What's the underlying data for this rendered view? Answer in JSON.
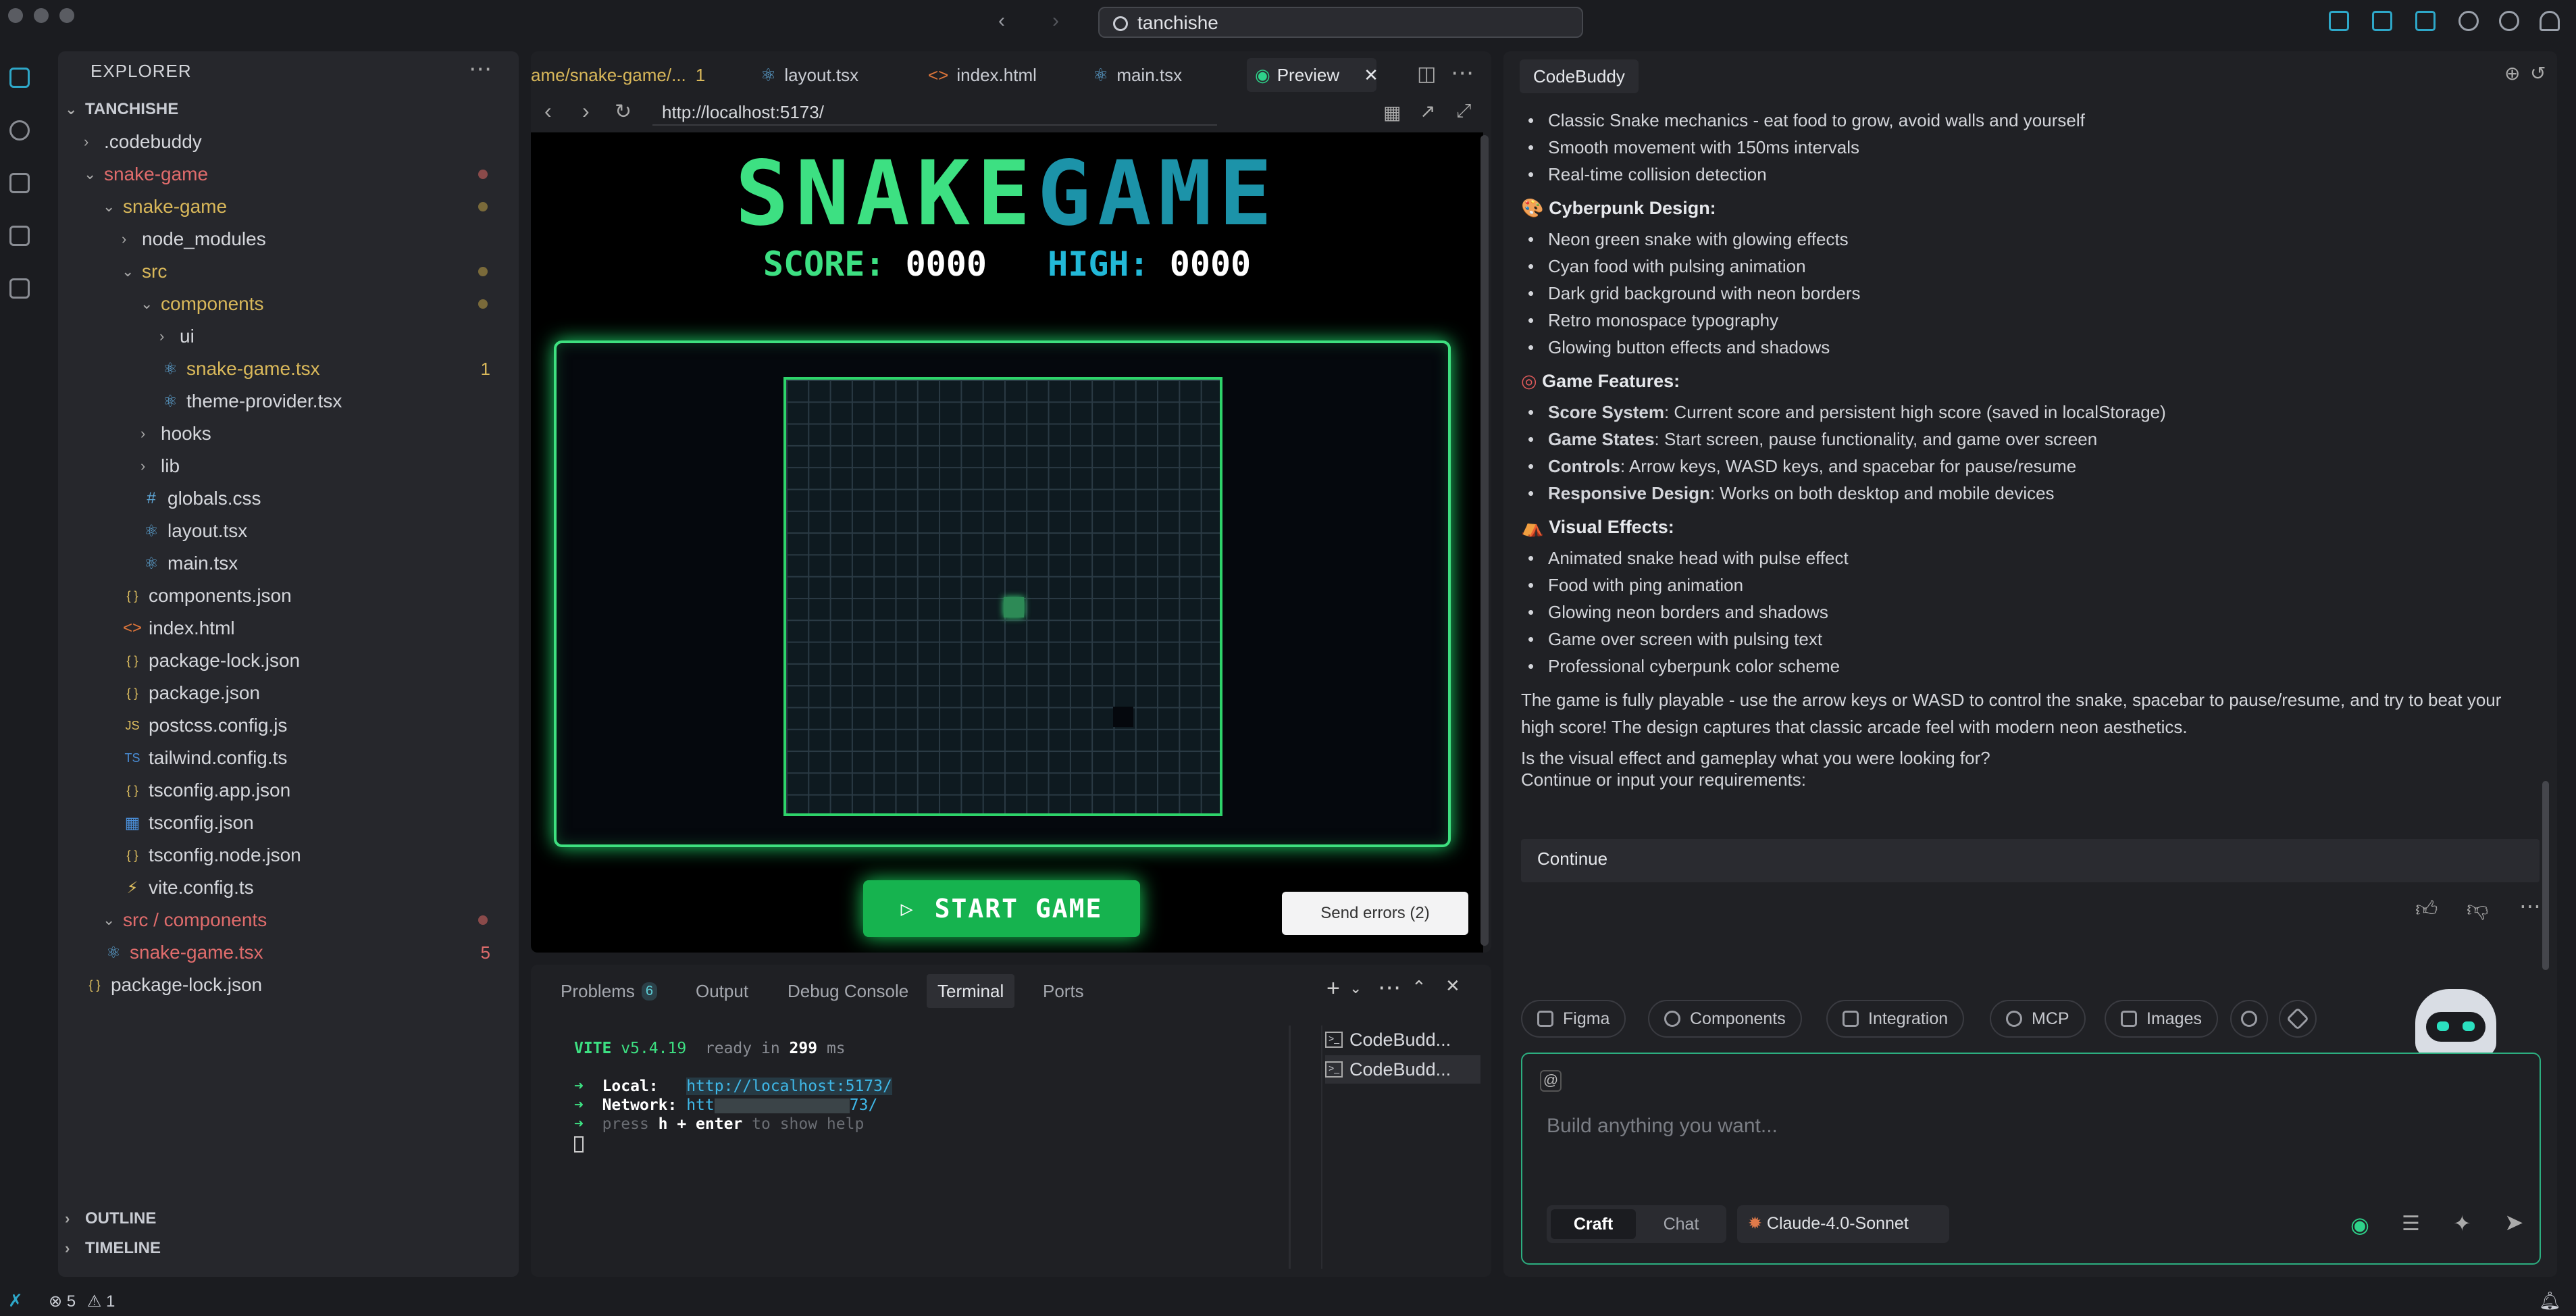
{
  "titlebar": {
    "search": "tanchishe"
  },
  "explorer": {
    "header": "EXPLORER",
    "root": "TANCHISHE",
    "items": [
      {
        "label": ".codebuddy",
        "indent": 1,
        "kind": "folder",
        "open": false,
        "color": "#d5d7dc"
      },
      {
        "label": "snake-game",
        "indent": 1,
        "kind": "folder",
        "open": true,
        "color": "#e06c6c",
        "dot": true
      },
      {
        "label": "snake-game",
        "indent": 2,
        "kind": "folder",
        "open": true,
        "color": "#d9b85a",
        "dot": true
      },
      {
        "label": "node_modules",
        "indent": 3,
        "kind": "folder",
        "open": false,
        "color": "#d5d7dc"
      },
      {
        "label": "src",
        "indent": 3,
        "kind": "folder",
        "open": true,
        "color": "#d9b85a",
        "dot": true
      },
      {
        "label": "components",
        "indent": 4,
        "kind": "folder",
        "open": true,
        "color": "#d9b85a",
        "dot": true
      },
      {
        "label": "ui",
        "indent": 5,
        "kind": "folder",
        "open": false,
        "color": "#d5d7dc"
      },
      {
        "label": "snake-game.tsx",
        "indent": 5,
        "kind": "react",
        "color": "#d9b85a",
        "count": "1",
        "countColor": "#d9b85a"
      },
      {
        "label": "theme-provider.tsx",
        "indent": 5,
        "kind": "react",
        "color": "#d5d7dc"
      },
      {
        "label": "hooks",
        "indent": 4,
        "kind": "folder",
        "open": false,
        "color": "#d5d7dc"
      },
      {
        "label": "lib",
        "indent": 4,
        "kind": "folder",
        "open": false,
        "color": "#d5d7dc"
      },
      {
        "label": "globals.css",
        "indent": 4,
        "kind": "css",
        "color": "#d5d7dc"
      },
      {
        "label": "layout.tsx",
        "indent": 4,
        "kind": "react",
        "color": "#d5d7dc"
      },
      {
        "label": "main.tsx",
        "indent": 4,
        "kind": "react",
        "color": "#d5d7dc"
      },
      {
        "label": "components.json",
        "indent": 3,
        "kind": "json",
        "color": "#d5d7dc"
      },
      {
        "label": "index.html",
        "indent": 3,
        "kind": "html",
        "color": "#d5d7dc"
      },
      {
        "label": "package-lock.json",
        "indent": 3,
        "kind": "json",
        "color": "#d5d7dc"
      },
      {
        "label": "package.json",
        "indent": 3,
        "kind": "json",
        "color": "#d5d7dc"
      },
      {
        "label": "postcss.config.js",
        "indent": 3,
        "kind": "js",
        "color": "#d5d7dc"
      },
      {
        "label": "tailwind.config.ts",
        "indent": 3,
        "kind": "ts",
        "color": "#d5d7dc"
      },
      {
        "label": "tsconfig.app.json",
        "indent": 3,
        "kind": "json",
        "color": "#d5d7dc"
      },
      {
        "label": "tsconfig.json",
        "indent": 3,
        "kind": "tsconfig",
        "color": "#d5d7dc"
      },
      {
        "label": "tsconfig.node.json",
        "indent": 3,
        "kind": "json",
        "color": "#d5d7dc"
      },
      {
        "label": "vite.config.ts",
        "indent": 3,
        "kind": "vite",
        "color": "#d5d7dc"
      },
      {
        "label": "src / components",
        "indent": 2,
        "kind": "folder",
        "open": true,
        "color": "#e06c6c",
        "dot": true
      },
      {
        "label": "snake-game.tsx",
        "indent": 2,
        "kind": "react",
        "color": "#e06c6c",
        "count": "5",
        "countColor": "#e06c6c"
      },
      {
        "label": "package-lock.json",
        "indent": 1,
        "kind": "json",
        "color": "#d5d7dc"
      }
    ],
    "outline": "OUTLINE",
    "timeline": "TIMELINE"
  },
  "editor": {
    "tabs": [
      {
        "label": "ame/snake-game/...",
        "badge": "1",
        "color": "#d9b85a"
      },
      {
        "label": "layout.tsx",
        "color": "#a9acb3"
      },
      {
        "label": "index.html",
        "color": "#a9acb3"
      },
      {
        "label": "main.tsx",
        "color": "#a9acb3"
      },
      {
        "label": "Preview",
        "color": "#e6e8ec"
      }
    ],
    "url": "http://localhost:5173/",
    "game": {
      "title_a": "SNAKE",
      "title_b": "GAME",
      "score_label": "SCORE:",
      "score": "0000",
      "high_label": "HIGH:",
      "high": "0000",
      "start": "START GAME",
      "send_errors": "Send errors (2)"
    }
  },
  "panel": {
    "tabs": [
      {
        "label": "Problems",
        "badge": "6"
      },
      {
        "label": "Output"
      },
      {
        "label": "Debug Console"
      },
      {
        "label": "Terminal"
      },
      {
        "label": "Ports"
      }
    ],
    "terminal": {
      "vite": "VITE",
      "version": "v5.4.19",
      "ready": "ready in",
      "ms": "299",
      "ms_unit": "ms",
      "local_label": "Local:",
      "local_url": "http://localhost:5173/",
      "network_label": "Network:",
      "network_url": "htt",
      "network_tail": "73/",
      "press": "press",
      "h_enter": "h + enter",
      "show_help": "to show help"
    },
    "instances": [
      "CodeBudd...",
      "CodeBudd..."
    ]
  },
  "chat": {
    "tab": "CodeBuddy",
    "gameplay_bullets": [
      "Classic Snake mechanics - eat food to grow, avoid walls and yourself",
      "Smooth movement with 150ms intervals",
      "Real-time collision detection"
    ],
    "design_heading": "Cyberpunk Design:",
    "design_bullets": [
      "Neon green snake with glowing effects",
      "Cyan food with pulsing animation",
      "Dark grid background with neon borders",
      "Retro monospace typography",
      "Glowing button effects and shadows"
    ],
    "features_heading": "Game Features:",
    "features": [
      {
        "b": "Score System",
        "t": ": Current score and persistent high score (saved in localStorage)"
      },
      {
        "b": "Game States",
        "t": ": Start screen, pause functionality, and game over screen"
      },
      {
        "b": "Controls",
        "t": ": Arrow keys, WASD keys, and spacebar for pause/resume"
      },
      {
        "b": "Responsive Design",
        "t": ": Works on both desktop and mobile devices"
      }
    ],
    "visual_heading": "Visual Effects:",
    "visual_bullets": [
      "Animated snake head with pulse effect",
      "Food with ping animation",
      "Glowing neon borders and shadows",
      "Game over screen with pulsing text",
      "Professional cyberpunk color scheme"
    ],
    "summary": "The game is fully playable - use the arrow keys or WASD to control the snake, spacebar to pause/resume, and try to beat your high score! The design captures that classic arcade feel with modern neon aesthetics.",
    "question": "Is the visual effect and gameplay what you were looking for?",
    "prompt": "Continue or input your requirements:",
    "continue": "Continue",
    "chips": [
      "Figma",
      "Components",
      "Integration",
      "MCP",
      "Images"
    ],
    "input_placeholder": "Build anything you want...",
    "at_symbol": "@",
    "mode_craft": "Craft",
    "mode_chat": "Chat",
    "model": "Claude-4.0-Sonnet"
  },
  "statusbar": {
    "errors": "5",
    "warnings": "1"
  }
}
